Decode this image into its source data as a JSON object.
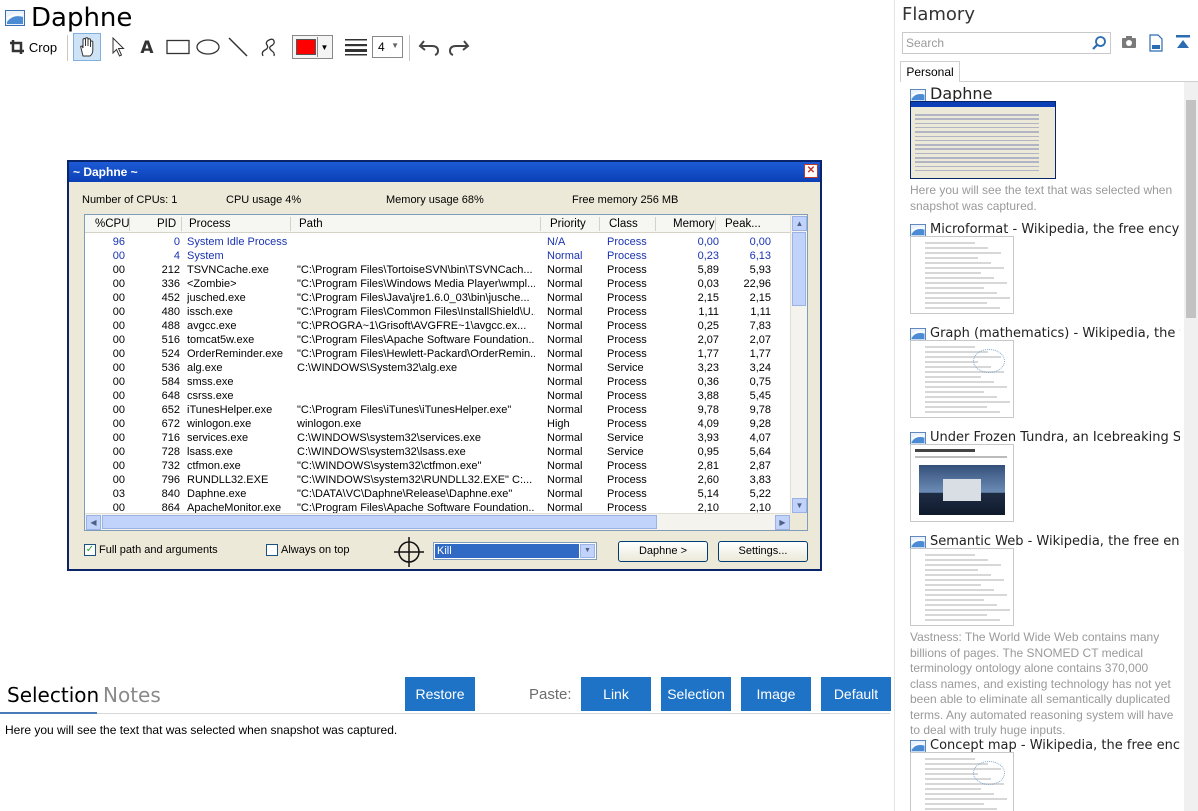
{
  "document": {
    "title": "Daphne"
  },
  "toolbar": {
    "crop_label": "Crop",
    "line_width": "4",
    "tools": [
      "hand-tool",
      "pointer-tool",
      "text-tool",
      "rectangle-tool",
      "ellipse-tool",
      "line-tool",
      "freehand-tool"
    ],
    "color": "#ff0000"
  },
  "snapshot": {
    "window_title": "~ Daphne ~",
    "stats": {
      "cpus": "Number of CPUs: 1",
      "cpu_usage": "CPU usage   4%",
      "memory_usage": "Memory usage  68%",
      "free_memory": "Free memory 256 MB"
    },
    "columns": [
      "%CPU",
      "PID",
      "Process",
      "Path",
      "Priority",
      "Class",
      "Memory",
      "Peak..."
    ],
    "rows": [
      {
        "cpu": "96",
        "pid": "0",
        "proc": "System Idle Process",
        "path": "",
        "prio": "N/A",
        "cls": "Process",
        "mem": "0,00",
        "peak": "0,00",
        "sys": true
      },
      {
        "cpu": "00",
        "pid": "4",
        "proc": "System",
        "path": "",
        "prio": "Normal",
        "cls": "Process",
        "mem": "0,23",
        "peak": "6,13",
        "sys": true
      },
      {
        "cpu": "00",
        "pid": "212",
        "proc": "TSVNCache.exe",
        "path": "\"C:\\Program Files\\TortoiseSVN\\bin\\TSVNCach...",
        "prio": "Normal",
        "cls": "Process",
        "mem": "5,89",
        "peak": "5,93"
      },
      {
        "cpu": "00",
        "pid": "336",
        "proc": "<Zombie>",
        "path": "\"C:\\Program Files\\Windows Media Player\\wmpl...",
        "prio": "Normal",
        "cls": "Process",
        "mem": "0,03",
        "peak": "22,96"
      },
      {
        "cpu": "00",
        "pid": "452",
        "proc": "jusched.exe",
        "path": "\"C:\\Program Files\\Java\\jre1.6.0_03\\bin\\jusche...",
        "prio": "Normal",
        "cls": "Process",
        "mem": "2,15",
        "peak": "2,15"
      },
      {
        "cpu": "00",
        "pid": "480",
        "proc": "issch.exe",
        "path": "\"C:\\Program Files\\Common Files\\InstallShield\\U...",
        "prio": "Normal",
        "cls": "Process",
        "mem": "1,11",
        "peak": "1,11"
      },
      {
        "cpu": "00",
        "pid": "488",
        "proc": "avgcc.exe",
        "path": "\"C:\\PROGRA~1\\Grisoft\\AVGFRE~1\\avgcc.ex...",
        "prio": "Normal",
        "cls": "Process",
        "mem": "0,25",
        "peak": "7,83"
      },
      {
        "cpu": "00",
        "pid": "516",
        "proc": "tomcat5w.exe",
        "path": "\"C:\\Program Files\\Apache Software Foundation...",
        "prio": "Normal",
        "cls": "Process",
        "mem": "2,07",
        "peak": "2,07"
      },
      {
        "cpu": "00",
        "pid": "524",
        "proc": "OrderReminder.exe",
        "path": "\"C:\\Program Files\\Hewlett-Packard\\OrderRemin...",
        "prio": "Normal",
        "cls": "Process",
        "mem": "1,77",
        "peak": "1,77"
      },
      {
        "cpu": "00",
        "pid": "536",
        "proc": "alg.exe",
        "path": "C:\\WINDOWS\\System32\\alg.exe",
        "prio": "Normal",
        "cls": "Service",
        "mem": "3,23",
        "peak": "3,24"
      },
      {
        "cpu": "00",
        "pid": "584",
        "proc": "smss.exe",
        "path": "",
        "prio": "Normal",
        "cls": "Process",
        "mem": "0,36",
        "peak": "0,75"
      },
      {
        "cpu": "00",
        "pid": "648",
        "proc": "csrss.exe",
        "path": "",
        "prio": "Normal",
        "cls": "Process",
        "mem": "3,88",
        "peak": "5,45"
      },
      {
        "cpu": "00",
        "pid": "652",
        "proc": "iTunesHelper.exe",
        "path": "\"C:\\Program Files\\iTunes\\iTunesHelper.exe\"",
        "prio": "Normal",
        "cls": "Process",
        "mem": "9,78",
        "peak": "9,78"
      },
      {
        "cpu": "00",
        "pid": "672",
        "proc": "winlogon.exe",
        "path": "winlogon.exe",
        "prio": "High",
        "cls": "Process",
        "mem": "4,09",
        "peak": "9,28"
      },
      {
        "cpu": "00",
        "pid": "716",
        "proc": "services.exe",
        "path": "C:\\WINDOWS\\system32\\services.exe",
        "prio": "Normal",
        "cls": "Service",
        "mem": "3,93",
        "peak": "4,07"
      },
      {
        "cpu": "00",
        "pid": "728",
        "proc": "lsass.exe",
        "path": "C:\\WINDOWS\\system32\\lsass.exe",
        "prio": "Normal",
        "cls": "Service",
        "mem": "0,95",
        "peak": "5,64"
      },
      {
        "cpu": "00",
        "pid": "732",
        "proc": "ctfmon.exe",
        "path": "\"C:\\WINDOWS\\system32\\ctfmon.exe\"",
        "prio": "Normal",
        "cls": "Process",
        "mem": "2,81",
        "peak": "2,87"
      },
      {
        "cpu": "00",
        "pid": "796",
        "proc": "RUNDLL32.EXE",
        "path": "\"C:\\WINDOWS\\system32\\RUNDLL32.EXE\" C:...",
        "prio": "Normal",
        "cls": "Process",
        "mem": "2,60",
        "peak": "3,83"
      },
      {
        "cpu": "03",
        "pid": "840",
        "proc": "Daphne.exe",
        "path": "\"C:\\DATA\\VC\\Daphne\\Release\\Daphne.exe\"",
        "prio": "Normal",
        "cls": "Process",
        "mem": "5,14",
        "peak": "5,22"
      },
      {
        "cpu": "00",
        "pid": "864",
        "proc": "ApacheMonitor.exe",
        "path": "\"C:\\Program Files\\Apache Software Foundation...",
        "prio": "Normal",
        "cls": "Process",
        "mem": "2,10",
        "peak": "2,10"
      }
    ],
    "footer": {
      "full_path_label": "Full path and arguments",
      "always_on_top_label": "Always on top",
      "kill_value": "Kill",
      "daphne_button": "Daphne >",
      "settings_button": "Settings..."
    }
  },
  "bottom": {
    "tab_selection": "Selection",
    "tab_notes": "Notes",
    "restore_button": "Restore",
    "paste_label": "Paste:",
    "paste_buttons": [
      "Link",
      "Selection",
      "Image",
      "Default"
    ],
    "selection_text": "Here you will see the text that was selected when snapshot was captured."
  },
  "sidebar": {
    "app_title": "Flamory",
    "search_placeholder": "Search",
    "tab_personal": "Personal",
    "cards": [
      {
        "title": "Daphne",
        "desc": "Here you will see the text that was selected when snapshot was captured."
      },
      {
        "title": "Microformat - Wikipedia, the free encyclopedia",
        "desc": ""
      },
      {
        "title": "Graph (mathematics) - Wikipedia, the free ency",
        "desc": ""
      },
      {
        "title": "Under Frozen Tundra, an Icebreaking Ship Unco",
        "desc": ""
      },
      {
        "title": "Semantic Web - Wikipedia, the free encycloped",
        "desc": "Vastness: The World Wide Web contains many billions of pages. The SNOMED CT medical terminology ontology alone contains 370,000 class names, and existing technology has not yet been able to eliminate all semantically duplicated terms. Any automated reasoning system will have to deal with truly huge inputs."
      },
      {
        "title": "Concept map - Wikipedia, the free encyclopedi",
        "desc": ""
      }
    ]
  },
  "colors": {
    "accent": "#1f73c6",
    "xp_title": "#0b3fb5",
    "xp_face": "#ece9d8"
  }
}
